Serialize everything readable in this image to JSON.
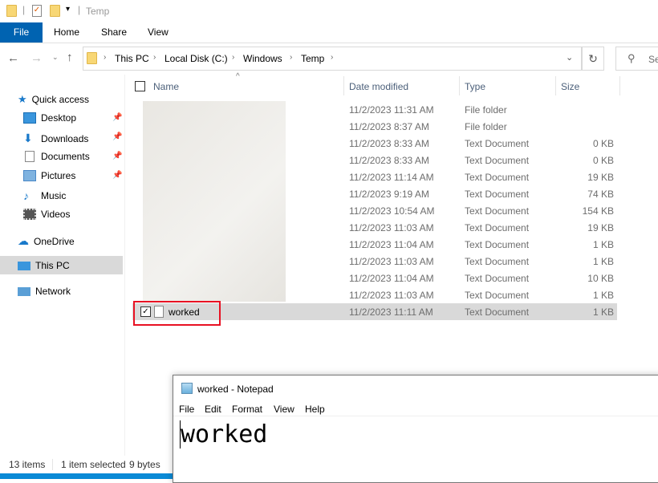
{
  "window": {
    "title": "Temp"
  },
  "ribbon": {
    "tabs": [
      "File",
      "Home",
      "Share",
      "View"
    ]
  },
  "address": {
    "crumbs": [
      "This PC",
      "Local Disk (C:)",
      "Windows",
      "Temp"
    ],
    "search_placeholder": "Se"
  },
  "sidebar": {
    "items": [
      {
        "label": "Quick access",
        "icon": "star-icon"
      },
      {
        "label": "Desktop",
        "icon": "desktop-icon",
        "pinned": true
      },
      {
        "label": "Downloads",
        "icon": "download-icon",
        "pinned": true
      },
      {
        "label": "Documents",
        "icon": "documents-icon",
        "pinned": true
      },
      {
        "label": "Pictures",
        "icon": "pictures-icon",
        "pinned": true
      },
      {
        "label": "Music",
        "icon": "music-icon"
      },
      {
        "label": "Videos",
        "icon": "videos-icon"
      },
      {
        "label": "OneDrive",
        "icon": "cloud-icon"
      },
      {
        "label": "This PC",
        "icon": "computer-icon",
        "selected": true
      },
      {
        "label": "Network",
        "icon": "network-icon"
      }
    ]
  },
  "columns": {
    "name": "Name",
    "date": "Date modified",
    "type": "Type",
    "size": "Size"
  },
  "files": [
    {
      "date": "11/2/2023 11:31 AM",
      "type": "File folder",
      "size": ""
    },
    {
      "date": "11/2/2023 8:37 AM",
      "type": "File folder",
      "size": ""
    },
    {
      "date": "11/2/2023 8:33 AM",
      "type": "Text Document",
      "size": "0 KB"
    },
    {
      "date": "11/2/2023 8:33 AM",
      "type": "Text Document",
      "size": "0 KB"
    },
    {
      "date": "11/2/2023 11:14 AM",
      "type": "Text Document",
      "size": "19 KB"
    },
    {
      "date": "11/2/2023 9:19 AM",
      "type": "Text Document",
      "size": "74 KB"
    },
    {
      "date": "11/2/2023 10:54 AM",
      "type": "Text Document",
      "size": "154 KB"
    },
    {
      "date": "11/2/2023 11:03 AM",
      "type": "Text Document",
      "size": "19 KB"
    },
    {
      "date": "11/2/2023 11:04 AM",
      "type": "Text Document",
      "size": "1 KB"
    },
    {
      "date": "11/2/2023 11:03 AM",
      "type": "Text Document",
      "size": "1 KB"
    },
    {
      "date": "11/2/2023 11:04 AM",
      "type": "Text Document",
      "size": "10 KB"
    },
    {
      "date": "11/2/2023 11:03 AM",
      "type": "Text Document",
      "size": "1 KB"
    }
  ],
  "selected_file": {
    "name": "worked",
    "date": "11/2/2023 11:11 AM",
    "type": "Text Document",
    "size": "1 KB"
  },
  "status": {
    "count": "13 items",
    "selected": "1 item selected",
    "bytes": "9 bytes"
  },
  "notepad": {
    "title": "worked - Notepad",
    "menu": [
      "File",
      "Edit",
      "Format",
      "View",
      "Help"
    ],
    "content": "worked"
  },
  "colors": {
    "accent": "#0063b1",
    "highlight": "#d9d9d9",
    "annotation": "#e81123"
  }
}
